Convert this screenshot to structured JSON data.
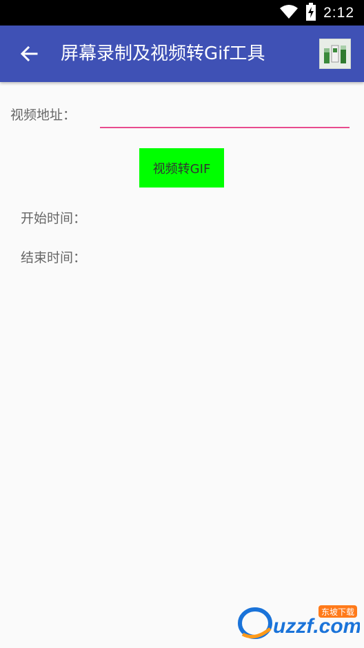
{
  "status_bar": {
    "time": "2:12",
    "icons": [
      "wifi-icon",
      "battery-charging-icon"
    ]
  },
  "app_bar": {
    "title": "屏幕录制及视频转Gif工具",
    "back_icon": "arrow-left-icon",
    "action_icon": "app-icon"
  },
  "form": {
    "video_label": "视频地址：",
    "video_value": "",
    "convert_button": "视频转GIF",
    "start_time_label": "开始时间：",
    "end_time_label": "结束时间："
  },
  "watermark": {
    "brand": "uzzf.com",
    "tag": "东坡下载"
  },
  "colors": {
    "status_bar": "#000000",
    "app_bar": "#3f51b5",
    "input_underline": "#e84a8d",
    "button": "#00ff00",
    "background": "#fafafa"
  }
}
